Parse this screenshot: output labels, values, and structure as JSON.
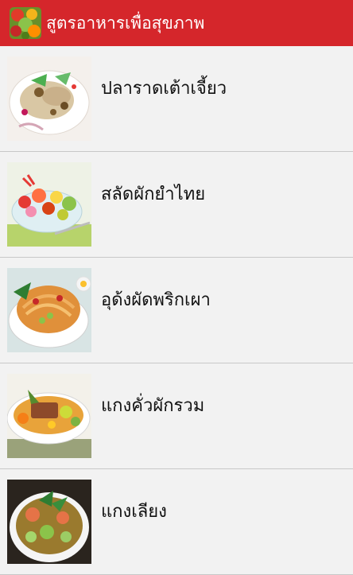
{
  "app": {
    "title": "สูตรอาหารเพื่อสุขภาพ"
  },
  "recipes": [
    {
      "name": "ปลาราดเต้าเจี้ยว"
    },
    {
      "name": "สลัดผักยำไทย"
    },
    {
      "name": "อุด้งผัดพริกเผา"
    },
    {
      "name": "แกงคั่วผักรวม"
    },
    {
      "name": "แกงเลียง"
    }
  ],
  "colors": {
    "appbar": "#d5262b",
    "background": "#f2f2f2",
    "divider": "#c8c8c8"
  }
}
